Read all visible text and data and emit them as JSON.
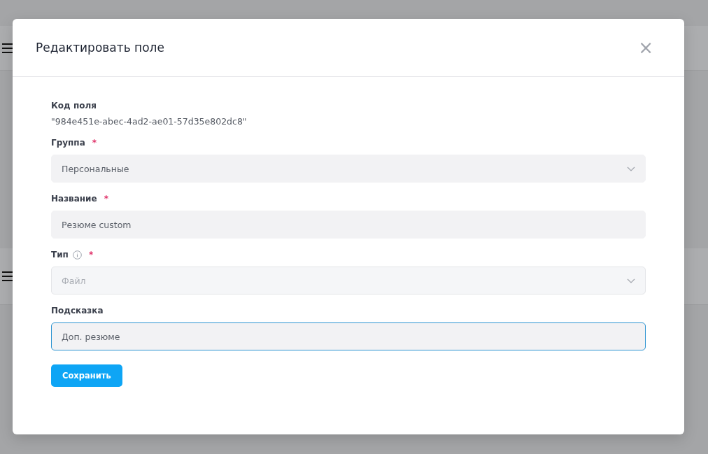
{
  "dialog": {
    "title": "Редактировать поле",
    "close_label": "×",
    "fields": [
      {
        "kind": "static",
        "label": "Код поля",
        "value": "\"984e451e-abec-4ad2-ae01-57d35e802dc8\""
      },
      {
        "kind": "select",
        "label": "Группа",
        "required_mark": "*",
        "value": "Персональные",
        "disabled": false,
        "focused": false
      },
      {
        "kind": "text",
        "label": "Название",
        "required_mark": "*",
        "value": "Резюме custom",
        "disabled": false,
        "focused": false
      },
      {
        "kind": "select",
        "label": "Тип",
        "info": true,
        "required_mark": "*",
        "value": "Файл",
        "disabled": true,
        "focused": false
      },
      {
        "kind": "text",
        "label": "Подсказка",
        "value": "Доп. резюме",
        "disabled": false,
        "focused": true
      }
    ],
    "save_button": "Сохранить"
  }
}
